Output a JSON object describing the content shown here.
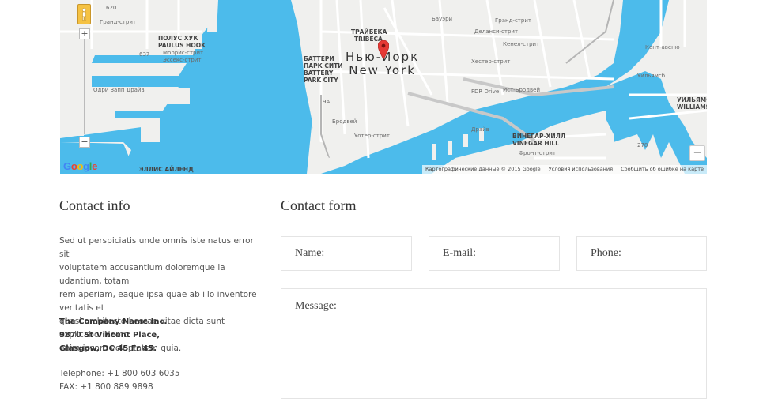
{
  "map": {
    "city_ru": "Нью-Йорк",
    "city_en": "New York",
    "zoom_in_label": "+",
    "zoom_out_label": "−",
    "zoom_out_large_label": "−",
    "google_logo": [
      "G",
      "o",
      "o",
      "g",
      "l",
      "e"
    ],
    "google_colors": [
      "#4285f4",
      "#ea4335",
      "#fbbc05",
      "#4285f4",
      "#34a853",
      "#ea4335"
    ],
    "attribution": {
      "data": "Картографические данные © 2015 Google",
      "terms": "Условия использования",
      "report": "Сообщить об ошибке на карте"
    },
    "labels": {
      "tribeca_ru": "ТРАЙБЕКА",
      "tribeca_en": "TRIBECA",
      "battery_ru1": "БАТТЕРИ",
      "battery_ru2": "ПАРК СИТИ",
      "battery_en1": "BATTERY",
      "battery_en2": "PARK CITY",
      "paulus_ru": "ПОЛУС ХУК",
      "paulus_en": "PAULUS HOOK",
      "vinegar_ru": "ВИНЕГАР-ХИЛЛ",
      "vinegar_en": "VINEGAR HILL",
      "williams_ru": "УИЛЬЯМСБ",
      "williams_en": "WILLIAMSB",
      "ellis": "ЭЛЛИС АЙЛЕНД",
      "grand_st": "Гранд-стрит",
      "morris_st": "Моррис-стрит",
      "essex_st": "Эссекс-стрит",
      "odri": "Одри Запп Драйв",
      "broadway": "Бродвей",
      "delancey": "Деланси-стрит",
      "grand_st2": "Гранд-стрит",
      "hester": "Хестер-стрит",
      "kenal": "Кенел-стрит",
      "bauery": "Бауэри",
      "east_bway": "Ист-Бродвей",
      "front_st": "Фронт-стрит",
      "uoter": "Уотер-стрит",
      "fdr": "FDR Drive",
      "drive_h": "Драйв",
      "highway_620": "620",
      "highway_637": "637",
      "highway_9a": "9A",
      "route_278": "278",
      "route_9a2": "9A",
      "kent_av": "Кент-авеню",
      "uilyams": "Уильямсб",
      "highway_27": "27"
    },
    "colors": {
      "water": "#4cbbeb",
      "land": "#f0f0ee",
      "road": "#ffffff",
      "pin": "#e53935"
    }
  },
  "contact_info": {
    "title": "Contact info",
    "lines": [
      "Sed ut perspiciatis unde omnis iste natus error sit",
      "voluptatem accusantium doloremque la udantium, totam",
      "rem aperiam, eaque ipsa quae ab illo inventore veritatis et",
      "quasi architecto beatae vitae dicta sunt explicabo. Nemo",
      "enim ipsam voluptatem quia."
    ],
    "company": "The Company Name Inc.",
    "street": "9870 St Vincent Place,",
    "city": "Glasgow, DC 45 Fr 45.",
    "telephone": "Telephone: +1 800 603 6035",
    "fax": "FAX: +1 800 889 9898"
  },
  "contact_form": {
    "title": "Contact form",
    "name_placeholder": "Name:",
    "email_placeholder": "E-mail:",
    "phone_placeholder": "Phone:",
    "message_placeholder": "Message:"
  }
}
